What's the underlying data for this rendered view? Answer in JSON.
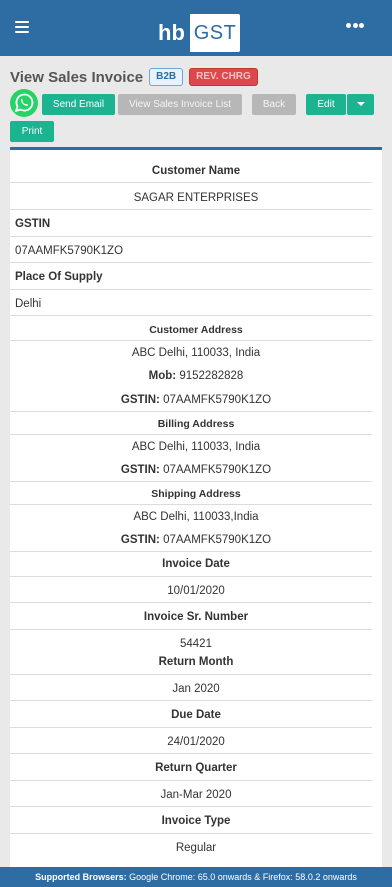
{
  "header": {
    "logo_left": "hb",
    "logo_right": "GST"
  },
  "page": {
    "title": "View Sales Invoice",
    "badge_b2b": "B2B",
    "badge_rev": "REV. CHRG"
  },
  "toolbar": {
    "send_email": "Send Email",
    "view_list": "View Sales Invoice List",
    "back": "Back",
    "edit": "Edit",
    "print": "Print"
  },
  "invoice": {
    "customer_name_label": "Customer Name",
    "customer_name": "SAGAR ENTERPRISES",
    "gstin_label": "GSTIN",
    "gstin": "07AAMFK5790K1ZO",
    "place_of_supply_label": "Place Of Supply",
    "place_of_supply": "Delhi",
    "customer_address_label": "Customer Address",
    "customer_address": "ABC Delhi, 110033, India",
    "mob_label": "Mob:",
    "mob": "9152282828",
    "cust_gstin_label": "GSTIN:",
    "cust_gstin": "07AAMFK5790K1ZO",
    "billing_address_label": "Billing Address",
    "billing_address": "ABC Delhi, 110033, India",
    "bill_gstin_label": "GSTIN:",
    "bill_gstin": "07AAMFK5790K1ZO",
    "shipping_address_label": "Shipping Address",
    "shipping_address": "ABC Delhi, 110033,India",
    "ship_gstin_label": "GSTIN:",
    "ship_gstin": "07AAMFK5790K1ZO",
    "invoice_date_label": "Invoice Date",
    "invoice_date": "10/01/2020",
    "invoice_sr_label": "Invoice Sr. Number",
    "invoice_sr": "54421",
    "return_month_label": "Return Month",
    "return_month": "Jan 2020",
    "due_date_label": "Due Date",
    "due_date": "24/01/2020",
    "return_quarter_label": "Return Quarter",
    "return_quarter": "Jan-Mar 2020",
    "invoice_type_label": "Invoice Type",
    "invoice_type": "Regular"
  },
  "footer": {
    "label": "Supported Browsers:",
    "chrome": "Google Chrome: 65.0 onwards",
    "amp": "&",
    "firefox": "Firefox: 58.0.2 onwards"
  },
  "colors": {
    "brand_blue": "#2e6da4",
    "action_green": "#1cb391",
    "badge_red": "#e0474c"
  },
  "icons": {
    "menu": "hamburger-icon",
    "more": "more-dots-icon",
    "share": "whatsapp-icon",
    "dropdown": "caret-down-icon"
  }
}
